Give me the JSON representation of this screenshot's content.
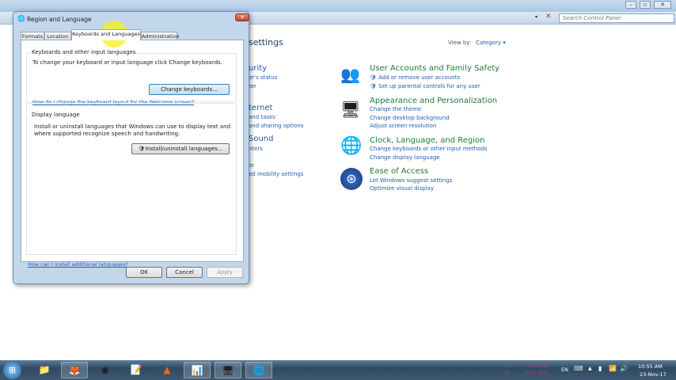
{
  "control_panel": {
    "search_placeholder": "Search Control Panel",
    "heading_partial": "settings",
    "view_by_label": "View by:",
    "view_by_value": "Category",
    "left_partial": [
      "urity",
      "er's status",
      "ter",
      "ternet",
      "and tasks",
      "and sharing options",
      "Sound",
      "nters",
      "or",
      "ed mobility settings"
    ],
    "categories": [
      {
        "title": "User Accounts and Family Safety",
        "icon": "users-icon",
        "links": [
          "Add or remove user accounts",
          "Set up parental controls for any user"
        ]
      },
      {
        "title": "Appearance and Personalization",
        "icon": "monitor-palette-icon",
        "links": [
          "Change the theme",
          "Change desktop background",
          "Adjust screen resolution"
        ]
      },
      {
        "title": "Clock, Language, and Region",
        "icon": "globe-clock-icon",
        "links": [
          "Change keyboards or other input methods",
          "Change display language"
        ]
      },
      {
        "title": "Ease of Access",
        "icon": "ease-of-access-icon",
        "links": [
          "Let Windows suggest settings",
          "Optimize visual display"
        ]
      }
    ]
  },
  "dialog": {
    "title": "Region and Language",
    "tabs": [
      "Formats",
      "Location",
      "Keyboards and Languages",
      "Administrative"
    ],
    "active_tab": "Keyboards and Languages",
    "keyboards_group": {
      "title": "Keyboards and other input languages",
      "text": "To change your keyboard or input language click Change keyboards.",
      "button": "Change keyboards...",
      "link": "How do I change the keyboard layout for the Welcome screen?"
    },
    "display_group": {
      "title": "Display language",
      "text1": "Install or uninstall languages that Windows can use to display text and",
      "text2": "where supported recognize speech and handwriting.",
      "button": "Install/uninstall languages..."
    },
    "bottom_link": "How can I install additional languages?",
    "ok": "OK",
    "cancel": "Cancel",
    "apply": "Apply"
  },
  "taskbar": {
    "apps": [
      "start",
      "explorer",
      "firefox",
      "chrome",
      "notepad",
      "vlc",
      "powerpoint",
      "control-panel",
      "region-language"
    ],
    "net_up_label": "U:",
    "net_down_label": "D:",
    "net_up": "0.00 kB/s",
    "net_down": "0.00 kB/s",
    "lang": "EN",
    "time": "10:55 AM",
    "date": "23-Nov-17"
  },
  "colors": {
    "link": "#1a5fb4",
    "category": "#1f7a3a",
    "accent": "#c2d7ec"
  }
}
